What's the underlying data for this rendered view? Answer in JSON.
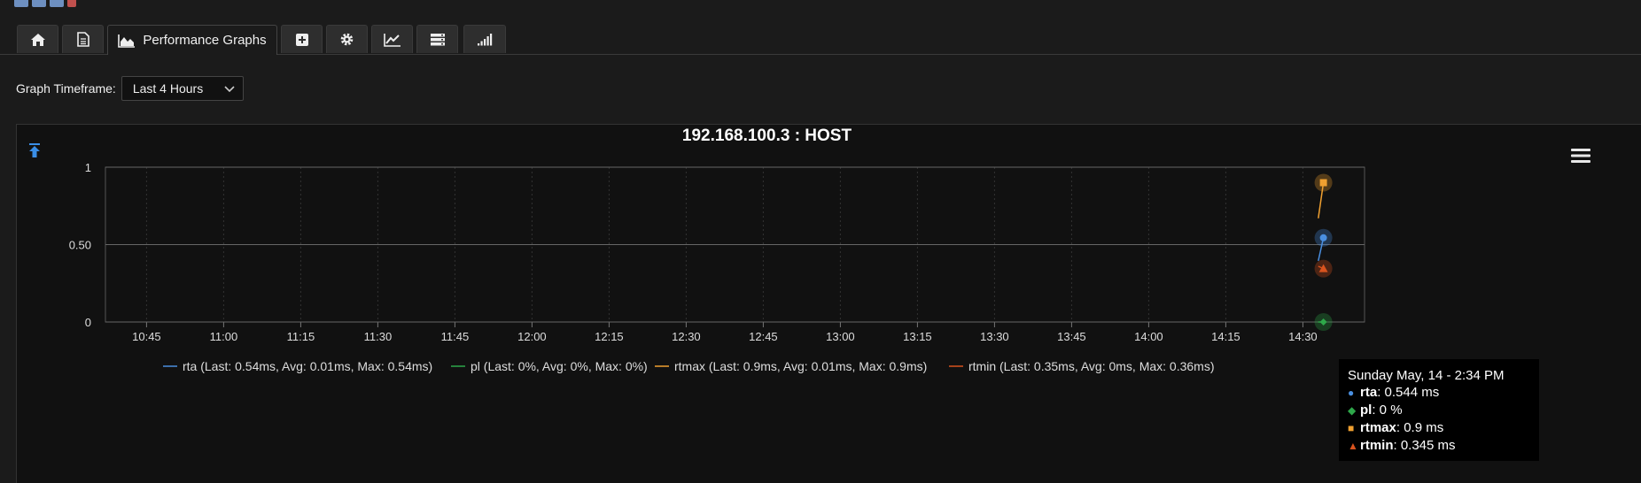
{
  "tabs": [
    {
      "name": "home",
      "label": ""
    },
    {
      "name": "document",
      "label": ""
    },
    {
      "name": "performance-graphs",
      "label": "Performance Graphs"
    },
    {
      "name": "add",
      "label": ""
    },
    {
      "name": "settings",
      "label": ""
    },
    {
      "name": "trends",
      "label": ""
    },
    {
      "name": "list",
      "label": ""
    },
    {
      "name": "signal",
      "label": ""
    }
  ],
  "timeframe": {
    "label": "Graph Timeframe:",
    "selected": "Last 4 Hours"
  },
  "colors": {
    "rta": "#4a8fe0",
    "pl": "#2ea84a",
    "rtmax": "#f0a030",
    "rtmin": "#d9531e",
    "accent": "#3a8ee6"
  },
  "tooltip": {
    "title": "Sunday May, 14 - 2:34 PM",
    "rows": [
      {
        "name": "rta",
        "value": ": 0.544 ms"
      },
      {
        "name": "pl",
        "value": ": 0 %"
      },
      {
        "name": "rtmax",
        "value": ": 0.9 ms"
      },
      {
        "name": "rtmin",
        "value": ": 0.345 ms"
      }
    ]
  },
  "chart_data": {
    "type": "line",
    "title": "192.168.100.3 : HOST",
    "xlabel": "",
    "ylabel": "",
    "x_ticks": [
      "10:45",
      "11:00",
      "11:15",
      "11:30",
      "11:45",
      "12:00",
      "12:15",
      "12:30",
      "12:45",
      "13:00",
      "13:15",
      "13:30",
      "13:45",
      "14:00",
      "14:15",
      "14:30"
    ],
    "x_range": [
      "10:37",
      "14:42"
    ],
    "y_ticks": [
      "0",
      "0.50",
      "1"
    ],
    "ylim": [
      0,
      1
    ],
    "grid": true,
    "legend_position": "bottom",
    "series": [
      {
        "name": "rta",
        "legend": "rta (Last: 0.54ms, Avg: 0.01ms, Max: 0.54ms)",
        "marker": "circle",
        "points": [
          {
            "x": "14:33",
            "y": 0.395
          },
          {
            "x": "14:34",
            "y": 0.544
          }
        ]
      },
      {
        "name": "pl",
        "legend": "pl (Last: 0%, Avg: 0%, Max: 0%)",
        "marker": "diamond",
        "points": [
          {
            "x": "14:33",
            "y": 0
          },
          {
            "x": "14:34",
            "y": 0
          }
        ]
      },
      {
        "name": "rtmax",
        "legend": "rtmax (Last: 0.9ms, Avg: 0.01ms, Max: 0.9ms)",
        "marker": "square",
        "points": [
          {
            "x": "14:33",
            "y": 0.67
          },
          {
            "x": "14:34",
            "y": 0.9
          }
        ]
      },
      {
        "name": "rtmin",
        "legend": "rtmin (Last: 0.35ms, Avg: 0ms, Max: 0.36ms)",
        "marker": "triangle",
        "points": [
          {
            "x": "14:33",
            "y": 0.36
          },
          {
            "x": "14:34",
            "y": 0.345
          }
        ]
      }
    ]
  }
}
